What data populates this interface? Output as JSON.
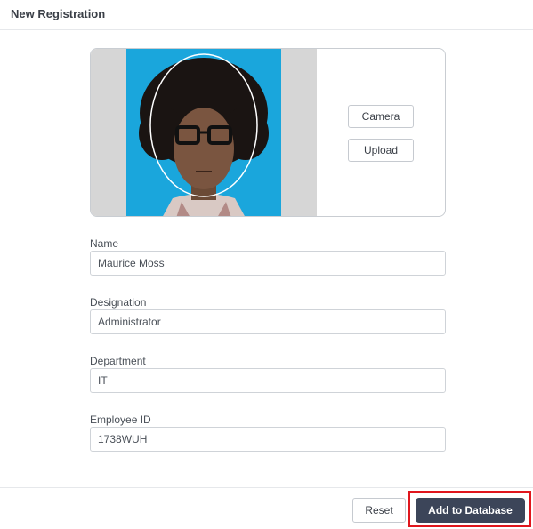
{
  "dialog": {
    "title": "New Registration"
  },
  "photo": {
    "camera_label": "Camera",
    "upload_label": "Upload"
  },
  "form": {
    "name": {
      "label": "Name",
      "value": "Maurice Moss"
    },
    "designation": {
      "label": "Designation",
      "value": "Administrator"
    },
    "department": {
      "label": "Department",
      "value": "IT"
    },
    "employee_id": {
      "label": "Employee ID",
      "value": "1738WUH"
    }
  },
  "footer": {
    "reset_label": "Reset",
    "submit_label": "Add to Database"
  },
  "colors": {
    "primary": "#3c4559",
    "photo_bg": "#1aa6dc",
    "highlight": "#e0161d"
  }
}
